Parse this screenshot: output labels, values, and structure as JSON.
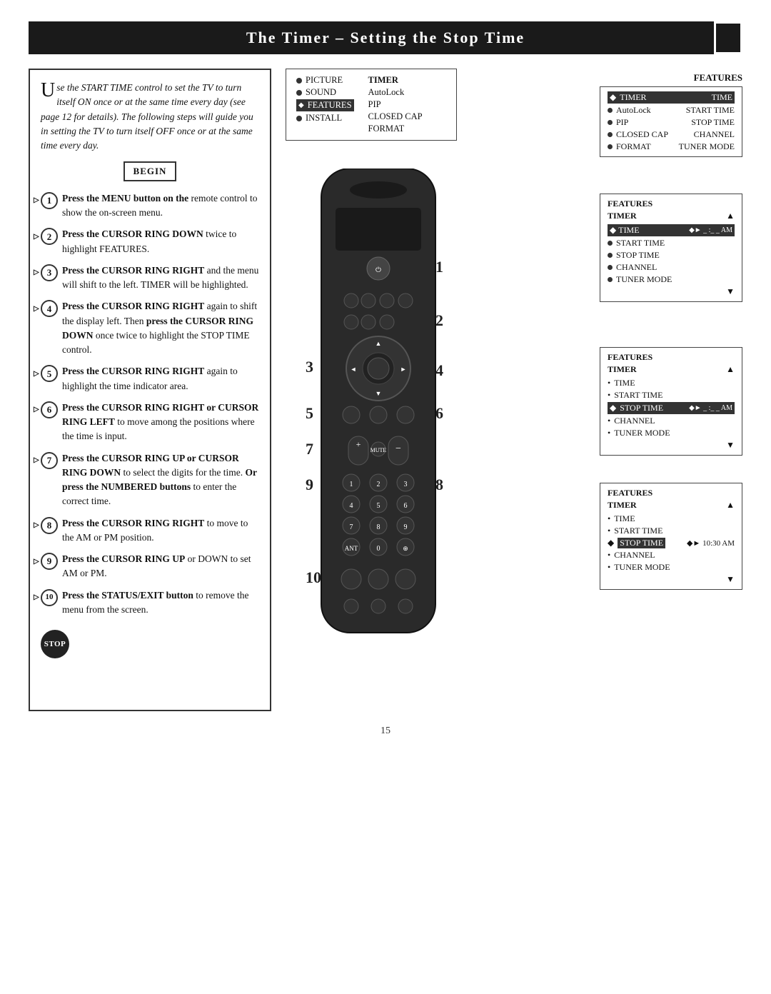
{
  "page": {
    "title": "The Timer – Setting the Stop Time",
    "page_number": "15"
  },
  "intro": {
    "drop_cap": "U",
    "text": "se the START TIME control to set the TV to turn itself ON once or at the same time every day (see page 12 for details). The following steps will guide you in setting the TV to turn itself OFF once or at the same time every day.",
    "begin_label": "BEGIN"
  },
  "steps": [
    {
      "num": "1",
      "text": "Press the MENU button on the remote control to show the on-screen menu."
    },
    {
      "num": "2",
      "text": "Press the CURSOR RING DOWN twice to highlight FEATURES."
    },
    {
      "num": "3",
      "text": "Press the CURSOR RING RIGHT and the menu will shift to the left. TIMER will be highlighted."
    },
    {
      "num": "4",
      "text": "Press the CURSOR RING RIGHT again to shift the display left. Then press the CURSOR RING DOWN once twice to highlight the STOP TIME control."
    },
    {
      "num": "5",
      "text": "Press the CURSOR RING RIGHT again to highlight the time indicator area."
    },
    {
      "num": "6",
      "text": "Press the CURSOR RING RIGHT or CURSOR RING LEFT to move among the positions where the time is input."
    },
    {
      "num": "7",
      "text": "Press the CURSOR RING UP or CURSOR RING DOWN to select the digits for the time. Or press the NUMBERED buttons to enter the correct time."
    },
    {
      "num": "8",
      "text": "Press the CURSOR RING RIGHT to move to the AM or PM position."
    },
    {
      "num": "9",
      "text": "Press the CURSOR RING UP or DOWN to set AM or PM."
    },
    {
      "num": "10",
      "text": "Press the STATUS/EXIT button to remove the menu from the screen."
    }
  ],
  "stop_label": "STOP",
  "main_menu": {
    "items_left": [
      "PICTURE",
      "SOUND",
      "FEATURES",
      "INSTALL"
    ],
    "items_right": [
      "TIMER",
      "AutoLock",
      "PIP",
      "CLOSED CAP",
      "FORMAT"
    ],
    "features_label": "FEATURES"
  },
  "features_panel_1": {
    "title": "FEATURES",
    "subtitle": "TIMER",
    "items": [
      {
        "bullet": true,
        "label": "TIMER",
        "value": "TIME",
        "highlighted": true
      },
      {
        "bullet": true,
        "label": "AutoLock",
        "value": "START TIME"
      },
      {
        "bullet": true,
        "label": "PIP",
        "value": "STOP TIME"
      },
      {
        "bullet": true,
        "label": "CLOSED CAP",
        "value": "CHANNEL"
      },
      {
        "bullet": true,
        "label": "FORMAT",
        "value": "TUNER MODE"
      }
    ]
  },
  "features_panel_2": {
    "title": "FEATURES",
    "subtitle": "TIMER",
    "items": [
      {
        "bullet": false,
        "label": "TIME",
        "value": "▲",
        "highlighted": true,
        "arrow": "◆►  _ :_ _ AM"
      },
      {
        "bullet": true,
        "label": "START TIME"
      },
      {
        "bullet": true,
        "label": "STOP TIME"
      },
      {
        "bullet": true,
        "label": "CHANNEL"
      },
      {
        "bullet": true,
        "label": "TUNER MODE"
      },
      {
        "value": "▼"
      }
    ]
  },
  "features_panel_3": {
    "title": "FEATURES",
    "subtitle": "TIMER",
    "items": [
      {
        "label": "TIME"
      },
      {
        "label": "START TIME"
      },
      {
        "label": "STOP TIME",
        "highlighted": true,
        "arrow": "◆►  _ :_ _ AM"
      },
      {
        "label": "CHANNEL"
      },
      {
        "label": "TUNER MODE"
      },
      {
        "value": "▼"
      }
    ]
  },
  "features_panel_4": {
    "title": "FEATURES",
    "subtitle": "TIMER",
    "items": [
      {
        "label": "TIME"
      },
      {
        "label": "START TIME"
      },
      {
        "label": "STOP TIME",
        "value": "◆► 10:30 AM"
      },
      {
        "label": "CHANNEL"
      },
      {
        "label": "TUNER MODE"
      },
      {
        "value": "▼"
      }
    ]
  },
  "step_numbers_diagram": [
    "1",
    "2",
    "3",
    "4",
    "5",
    "6",
    "7",
    "8",
    "9",
    "10"
  ],
  "icons": {
    "corner": "□",
    "bullet": "●",
    "arrow_right": "►",
    "arrow_up": "▲",
    "arrow_down": "▼",
    "cursor_ring": "◎",
    "stop": "STOP"
  }
}
